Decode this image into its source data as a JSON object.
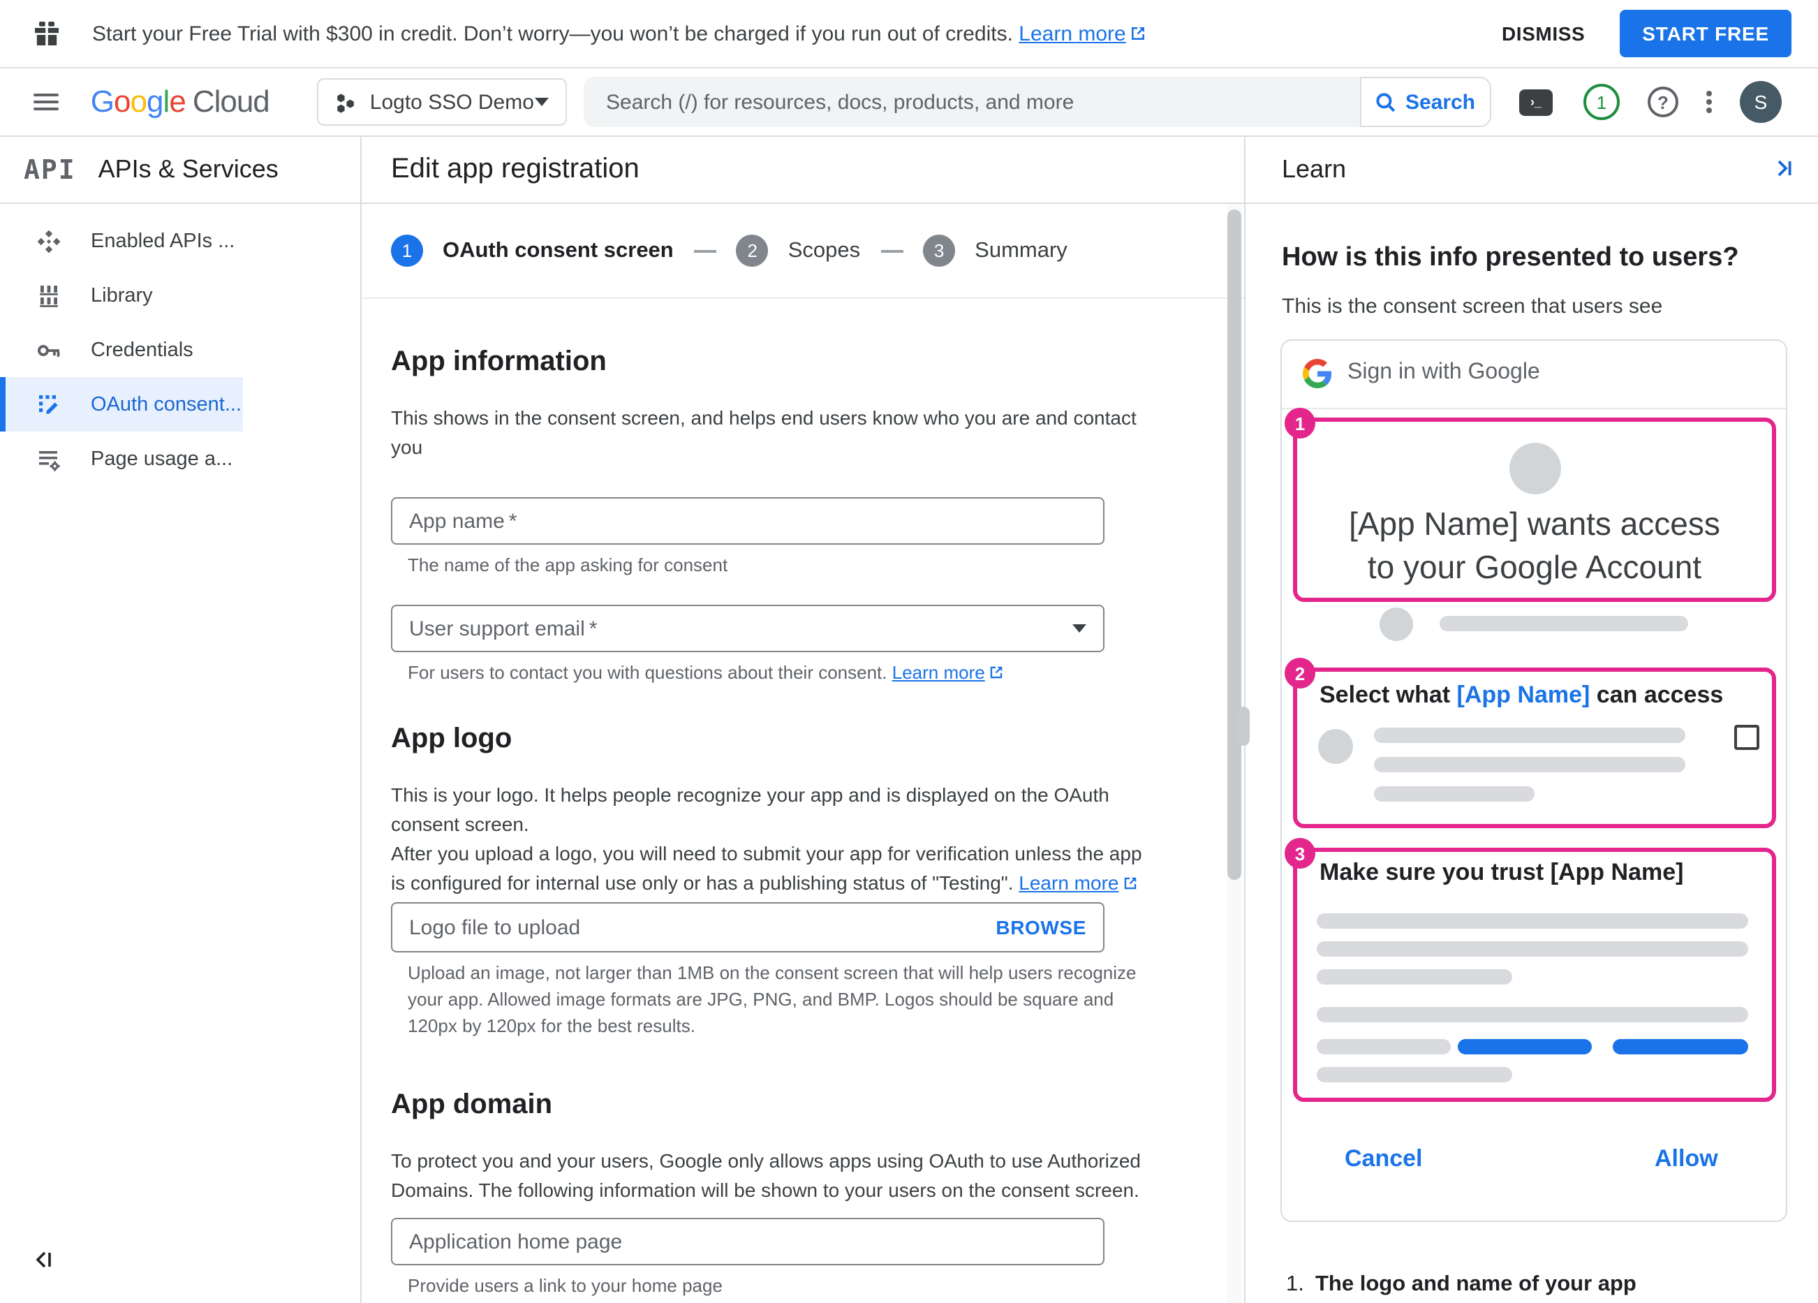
{
  "colors": {
    "accent_blue": "#1a73e8",
    "annotation_pink": "#e3258c",
    "green": "#1e8e3e",
    "text_dark": "#202124",
    "text_gray": "#5f6368",
    "divider": "#dadce0"
  },
  "banner": {
    "message": "Start your Free Trial with $300 in credit. Don’t worry—you won’t be charged if you run out of credits.",
    "learn_more": "Learn more",
    "dismiss": "DISMISS",
    "start_free": "START FREE"
  },
  "appbar": {
    "logo": {
      "g1": "G",
      "g2": "o",
      "g3": "o",
      "g4": "g",
      "g5": "l",
      "g6": "e",
      "cloud": "Cloud"
    },
    "project": "Logto SSO Demo",
    "search_placeholder": "Search (/) for resources, docs, products, and more",
    "search_button": "Search",
    "shell_prompt": "›_",
    "notification_count": "1",
    "help_glyph": "?",
    "avatar_initial": "S"
  },
  "sidebar": {
    "logo_abbr": "API",
    "title": "APIs & Services",
    "items": [
      {
        "label": "Enabled APIs ...",
        "icon": "enabled-apis-icon",
        "active": false
      },
      {
        "label": "Library",
        "icon": "library-icon",
        "active": false
      },
      {
        "label": "Credentials",
        "icon": "credentials-icon",
        "active": false
      },
      {
        "label": "OAuth consent...",
        "icon": "oauth-consent-icon",
        "active": true
      },
      {
        "label": "Page usage a...",
        "icon": "page-usage-icon",
        "active": false
      }
    ]
  },
  "main": {
    "title": "Edit app registration",
    "steps": [
      {
        "number": "1",
        "label": "OAuth consent screen",
        "state": "current"
      },
      {
        "number": "2",
        "label": "Scopes",
        "state": "upcoming"
      },
      {
        "number": "3",
        "label": "Summary",
        "state": "upcoming"
      }
    ],
    "app_info": {
      "heading": "App information",
      "desc_lines": [
        "This shows in the consent screen, and helps end users know who you are and contact",
        "you"
      ],
      "app_name": {
        "label": "App name",
        "required": "*",
        "helper": "The name of the app asking for consent"
      },
      "support_email": {
        "label": "User support email",
        "required": "*",
        "helper": "For users to contact you with questions about their consent.",
        "learn_more": "Learn more"
      }
    },
    "app_logo": {
      "heading": "App logo",
      "desc_lines": [
        "This is your logo. It helps people recognize your app and is displayed on the OAuth",
        "consent screen.",
        "After you upload a logo, you will need to submit your app for verification unless the app",
        "is configured for internal use only or has a publishing status of \"Testing\"."
      ],
      "learn_more": "Learn more",
      "upload": {
        "label": "Logo file to upload",
        "browse": "BROWSE",
        "helper_lines": [
          "Upload an image, not larger than 1MB on the consent screen that will help users recognize",
          "your app. Allowed image formats are JPG, PNG, and BMP. Logos should be square and",
          "120px by 120px for the best results."
        ]
      }
    },
    "app_domain": {
      "heading": "App domain",
      "desc_lines": [
        "To protect you and your users, Google only allows apps using OAuth to use Authorized",
        "Domains. The following information will be shown to your users on the consent screen."
      ],
      "home_page": {
        "label": "Application home page",
        "helper": "Provide users a link to your home page"
      }
    }
  },
  "learn": {
    "title": "Learn",
    "heading": "How is this info presented to users?",
    "subheading": "This is the consent screen that users see",
    "consent_preview": {
      "signin": "Sign in with Google",
      "step1": {
        "badge": "1",
        "title_line1": "[App Name] wants access",
        "title_line2": "to your Google Account"
      },
      "step2": {
        "badge": "2",
        "title_pre": "Select what ",
        "title_app": "[App Name]",
        "title_post": " can access"
      },
      "step3": {
        "badge": "3",
        "title": "Make sure you trust [App Name]"
      },
      "cancel": "Cancel",
      "allow": "Allow"
    },
    "list_item": {
      "number": "1.",
      "text": "The logo and name of your app"
    }
  }
}
